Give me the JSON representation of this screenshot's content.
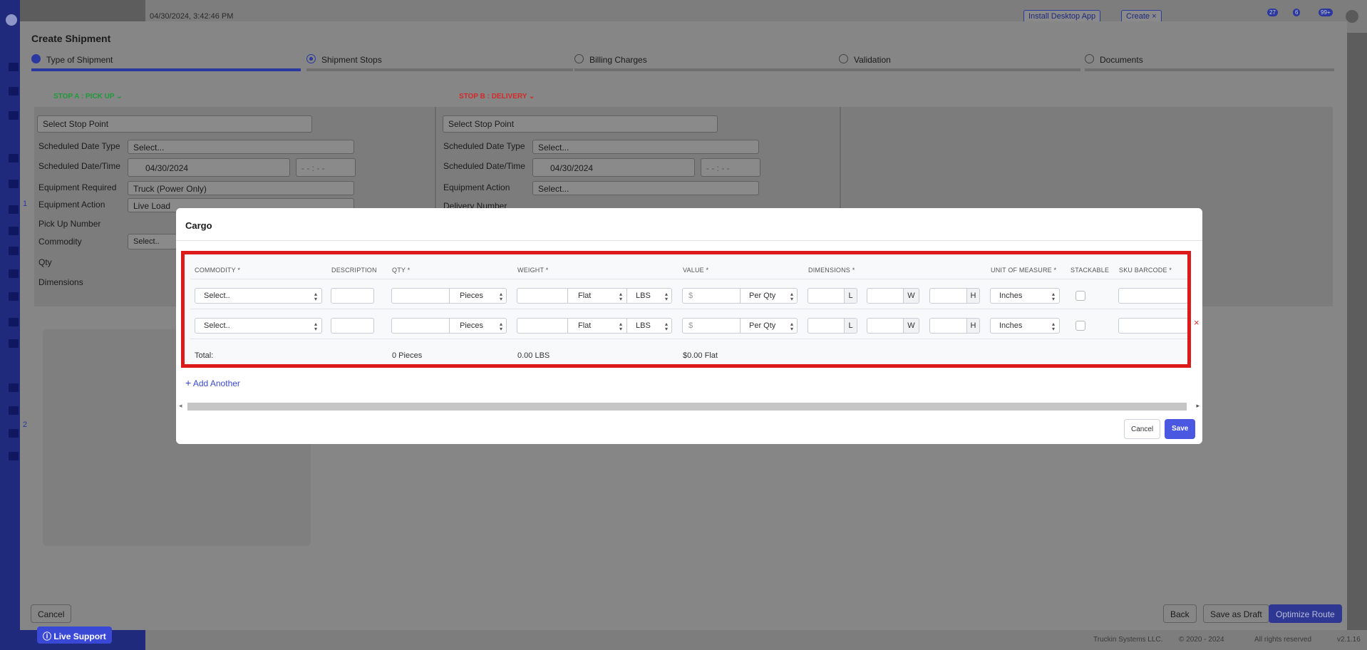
{
  "topbar": {
    "timestamp": "04/30/2024, 3:42:46 PM",
    "install_label": "Install Desktop App",
    "create_label": "Create ×",
    "badges": [
      "27",
      "6",
      "99+"
    ]
  },
  "footer": {
    "company": "Truckin Systems LLC.",
    "copyright": "© 2020 - 2024",
    "rights": "All rights reserved",
    "version": "v2.1.16"
  },
  "live_support": {
    "label": "Live Support"
  },
  "create_shipment": {
    "title": "Create Shipment",
    "steps": [
      {
        "label": "Type of Shipment",
        "status": "complete"
      },
      {
        "label": "Shipment Stops",
        "status": "current"
      },
      {
        "label": "Billing Charges",
        "status": "pending"
      },
      {
        "label": "Validation",
        "status": "pending"
      },
      {
        "label": "Documents",
        "status": "pending"
      }
    ],
    "stop_a": {
      "header": "STOP A : PICK UP",
      "header_color": "#1e9b3a",
      "stop_point": "Select Stop Point",
      "labels": {
        "scheduled_date_type": "Scheduled Date Type",
        "scheduled_date_time": "Scheduled Date/Time",
        "equipment_required": "Equipment Required",
        "equipment_action": "Equipment Action",
        "pickup_number": "Pick Up Number",
        "commodity": "Commodity",
        "qty": "Qty",
        "dimensions": "Dimensions"
      },
      "values": {
        "scheduled_date_type": "Select...",
        "date": "04/30/2024",
        "time": "- -   :   - -",
        "equipment_required": "Truck (Power Only)",
        "equipment_action": "Live Load",
        "commodity": "Select.."
      }
    },
    "stop_b": {
      "header": "STOP B : DELIVERY",
      "header_color": "#d42a2a",
      "stop_point": "Select Stop Point",
      "labels": {
        "scheduled_date_type": "Scheduled Date Type",
        "scheduled_date_time": "Scheduled Date/Time",
        "equipment_action": "Equipment Action",
        "delivery_number": "Delivery Number"
      },
      "values": {
        "scheduled_date_type": "Select...",
        "date": "04/30/2024",
        "time": "- -   :   - -",
        "equipment_action": "Select..."
      }
    },
    "row_numbers": [
      "1",
      "2"
    ],
    "buttons": {
      "cancel": "Cancel",
      "back": "Back",
      "save_draft": "Save as Draft",
      "optimize": "Optimize Route"
    }
  },
  "cargo_modal": {
    "title": "Cargo",
    "headers": {
      "commodity": "COMMODITY *",
      "description": "DESCRIPTION",
      "qty": "QTY *",
      "weight": "WEIGHT *",
      "value": "VALUE *",
      "dimensions": "DIMENSIONS *",
      "uom": "UNIT OF MEASURE *",
      "stackable": "STACKABLE",
      "sku": "SKU BARCODE *"
    },
    "rows": [
      {
        "commodity": "Select..",
        "qty_unit": "Pieces",
        "weight_type": "Flat",
        "weight_unit": "LBS",
        "value_prefix": "$",
        "value_type": "Per Qty",
        "dim_l": "L",
        "dim_w": "W",
        "dim_h": "H",
        "uom": "Inches"
      },
      {
        "commodity": "Select..",
        "qty_unit": "Pieces",
        "weight_type": "Flat",
        "weight_unit": "LBS",
        "value_prefix": "$",
        "value_type": "Per Qty",
        "dim_l": "L",
        "dim_w": "W",
        "dim_h": "H",
        "uom": "Inches"
      }
    ],
    "remove_symbol": "×",
    "totals": {
      "label": "Total:",
      "qty": "0 Pieces",
      "weight": "0.00 LBS",
      "value": "$0.00 Flat"
    },
    "add_another": "Add Another",
    "cancel": "Cancel",
    "save": "Save",
    "highlight_color": "#dd1a1a"
  }
}
